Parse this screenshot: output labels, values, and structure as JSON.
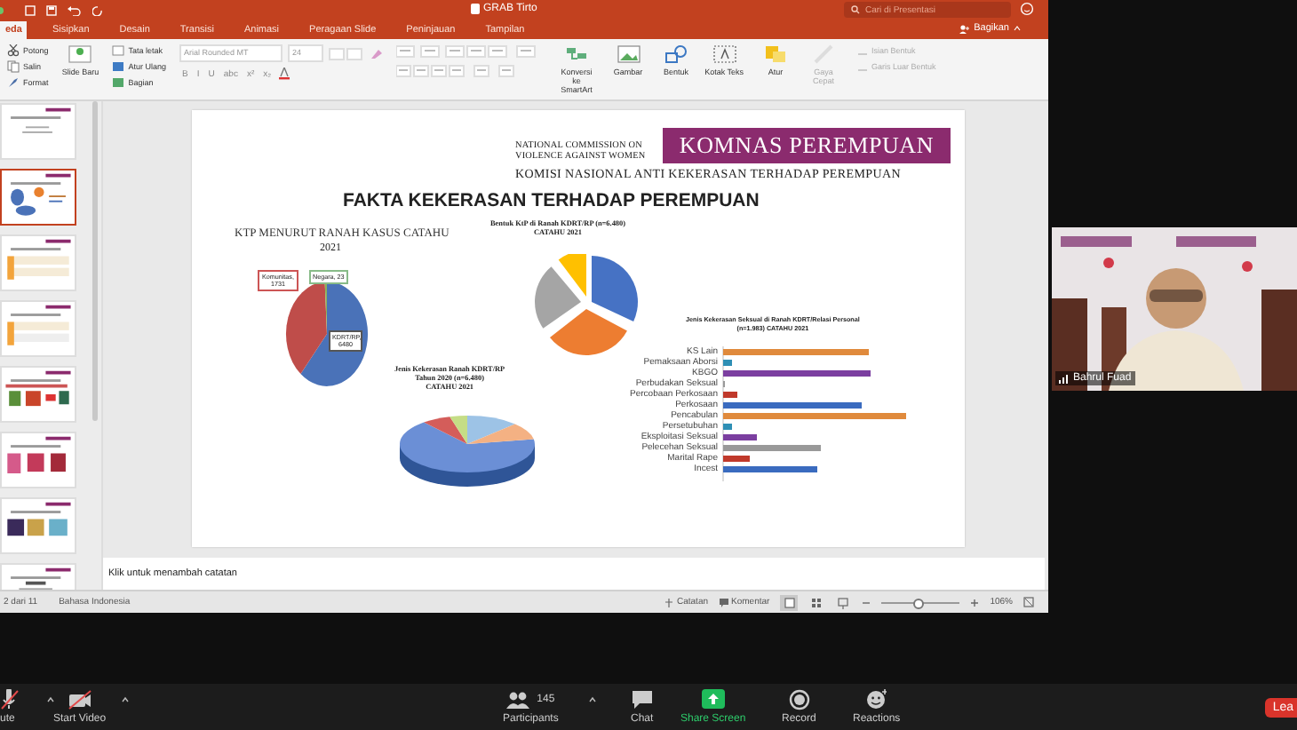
{
  "powerpoint": {
    "title": "GRAB Tirto",
    "search": {
      "placeholder": "Cari di Presentasi"
    },
    "share_button": "Bagikan",
    "tabs": [
      {
        "label": "eda",
        "selected": true
      },
      {
        "label": "Sisipkan",
        "selected": false
      },
      {
        "label": "Desain",
        "selected": false
      },
      {
        "label": "Transisi",
        "selected": false
      },
      {
        "label": "Animasi",
        "selected": false
      },
      {
        "label": "Peragaan Slide",
        "selected": false
      },
      {
        "label": "Peninjauan",
        "selected": false
      },
      {
        "label": "Tampilan",
        "selected": false
      }
    ],
    "ribbon": [
      {
        "kind": "small",
        "items": [
          {
            "label": "Potong",
            "disabled": false
          },
          {
            "label": "Salin",
            "disabled": false
          },
          {
            "label": "Format",
            "disabled": false
          }
        ]
      },
      {
        "kind": "large",
        "items": [
          {
            "label": "Slide Baru",
            "disabled": false
          }
        ]
      },
      {
        "kind": "small",
        "items": [
          {
            "label": "Tata letak",
            "disabled": false
          },
          {
            "label": "Atur Ulang",
            "disabled": false
          },
          {
            "label": "Bagian",
            "disabled": false
          }
        ]
      },
      {
        "kind": "font",
        "font": "Arial Rounded MT",
        "size": "24",
        "format_buttons": [
          "B",
          "I",
          "U",
          "abc",
          "x²",
          "x₂"
        ]
      },
      {
        "kind": "paragraph"
      },
      {
        "kind": "large",
        "items": [
          {
            "label": "Konversi ke SmartArt",
            "disabled": false
          }
        ]
      },
      {
        "kind": "large",
        "items": [
          {
            "label": "Gambar",
            "disabled": false
          },
          {
            "label": "Bentuk",
            "disabled": false
          },
          {
            "label": "Kotak Teks",
            "disabled": false
          }
        ]
      },
      {
        "kind": "large",
        "items": [
          {
            "label": "Atur",
            "disabled": false
          },
          {
            "label": "Gaya Cepat",
            "disabled": true
          }
        ]
      },
      {
        "kind": "small",
        "items": [
          {
            "label": "Isian Bentuk",
            "disabled": true
          },
          {
            "label": "Garis Luar Bentuk",
            "disabled": true
          }
        ]
      }
    ],
    "thumbnails": [
      {
        "selected": false
      },
      {
        "selected": true
      },
      {
        "selected": false
      },
      {
        "selected": false
      },
      {
        "selected": false
      },
      {
        "selected": false
      },
      {
        "selected": false
      },
      {
        "selected": false
      }
    ],
    "slide": {
      "logo": {
        "line_1": "NATIONAL COMMISSION ON",
        "line_2": "VIOLENCE AGAINST WOMEN",
        "name": "KOMNAS PEREMPUAN",
        "subtitle": "KOMISI NASIONAL ANTI KEKERASAN TERHADAP PEREMPUAN"
      },
      "title": "FAKTA KEKERASAN TERHADAP PEREMPUAN",
      "pie_1": {
        "title": "KTP MENURUT RANAH KASUS CATAHU",
        "year": "2021",
        "labels": [
          "Komunitas, 1731",
          "Negara, 23",
          "KDRT/RP, 6480"
        ]
      },
      "pie_2": {
        "title": "Bentuk KtP di Ranah KDRT/RP (n=6.480)",
        "subtitle": "CATAHU 2021"
      },
      "pie_3": {
        "title_lines": [
          "Jenis Kekerasan Ranah KDRT/RP",
          "Tahun 2020 (n=6.480)",
          "CATAHU 2021"
        ]
      },
      "bar_chart": {
        "title_lines": [
          "Jenis Kekerasan Seksual di Ranah KDRT/Relasi Personal",
          "(n=1.983) CATAHU 2021"
        ],
        "categories": [
          "KS Lain",
          "Pemaksaan Aborsi",
          "KBGO",
          "Perbudakan Seksual",
          "Percobaan Perkosaan",
          "Perkosaan",
          "Pencabulan",
          "Persetubuhan",
          "Eksploitasi Seksual",
          "Pelecehan Seksual",
          "Marital Rape",
          "Incest"
        ]
      }
    },
    "notes": {
      "placeholder": "Klik untuk menambah catatan"
    },
    "status_bar": {
      "slide_counter": "2 dari 11",
      "language": "Bahasa Indonesia",
      "notes_button": "Catatan",
      "comments_button": "Komentar",
      "views": [
        {
          "selected": true
        },
        {
          "selected": false
        },
        {
          "selected": false
        }
      ],
      "zoom_slider": {
        "level": 0.45
      },
      "zoom": "106%"
    }
  },
  "video": {
    "name": "Bahrul Fuad"
  },
  "zoom_toolbar": {
    "controls": [
      {
        "kind": "mic",
        "label": "ute"
      },
      {
        "kind": "video",
        "label": "Start Video"
      },
      {
        "kind": "participants",
        "label": "Participants",
        "count": "145"
      },
      {
        "kind": "chat",
        "label": "Chat"
      },
      {
        "kind": "share",
        "label": "Share Screen"
      },
      {
        "kind": "record",
        "label": "Record"
      },
      {
        "kind": "reactions",
        "label": "Reactions"
      }
    ],
    "leave_button": "Lea"
  }
}
